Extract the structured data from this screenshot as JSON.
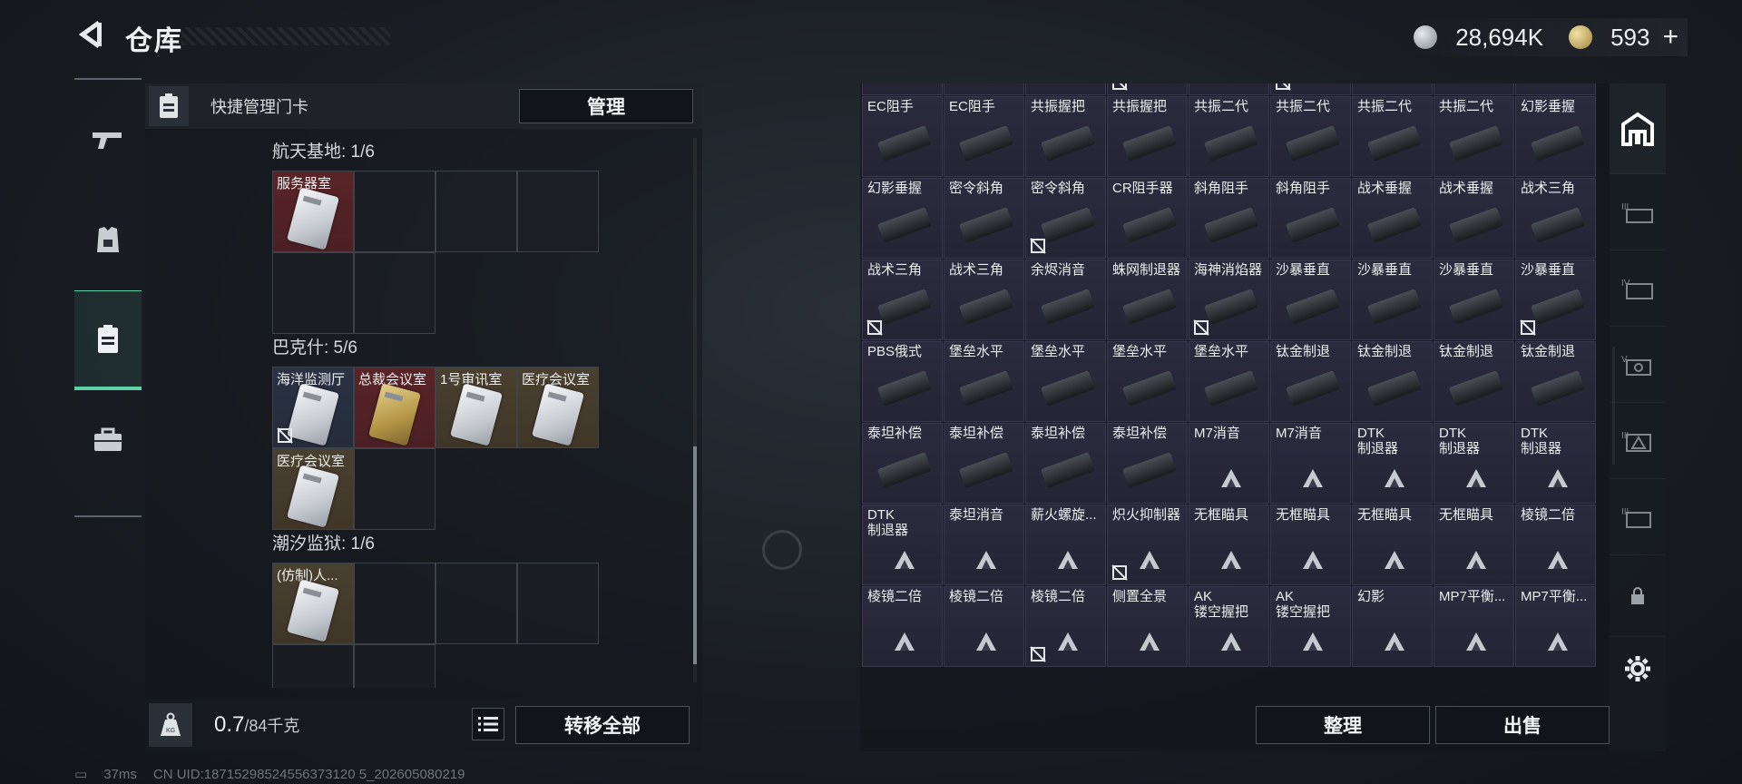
{
  "header": {
    "title": "仓库",
    "currency_silver": "28,694K",
    "currency_gold": "593",
    "currency_gold_add": "+"
  },
  "left_panel": {
    "keycard_label": "快捷管理门卡",
    "manage_label": "管理",
    "sections": [
      {
        "title": "航天基地: 1/6",
        "cards": [
          {
            "label": "服务器室"
          }
        ]
      },
      {
        "title": "巴克什: 5/6",
        "cards": [
          {
            "label": "海洋监测厅"
          },
          {
            "label": "总裁会议室"
          },
          {
            "label": "1号审讯室"
          },
          {
            "label": "医疗会议室"
          },
          {
            "label": "医疗会议室"
          }
        ]
      },
      {
        "title": "潮汐监狱: 1/6",
        "cards": [
          {
            "label": "(仿制)人..."
          }
        ]
      }
    ],
    "weight_value": "0.7",
    "weight_max": "/84千克",
    "transfer_label": "转移全部"
  },
  "right_panel": {
    "items": [
      {
        "name": ""
      },
      {
        "name": ""
      },
      {
        "name": ""
      },
      {
        "name": ""
      },
      {
        "name": ""
      },
      {
        "name": ""
      },
      {
        "name": ""
      },
      {
        "name": ""
      },
      {
        "name": ""
      },
      {
        "name": "EC阻手"
      },
      {
        "name": "EC阻手"
      },
      {
        "name": "共振握把"
      },
      {
        "name": "共振握把"
      },
      {
        "name": "共振二代"
      },
      {
        "name": "共振二代"
      },
      {
        "name": "共振二代"
      },
      {
        "name": "共振二代"
      },
      {
        "name": "幻影垂握"
      },
      {
        "name": "幻影垂握"
      },
      {
        "name": "密令斜角"
      },
      {
        "name": "密令斜角"
      },
      {
        "name": "CR阻手器"
      },
      {
        "name": "斜角阻手"
      },
      {
        "name": "斜角阻手"
      },
      {
        "name": "战术垂握"
      },
      {
        "name": "战术垂握"
      },
      {
        "name": "战术三角"
      },
      {
        "name": "战术三角"
      },
      {
        "name": "战术三角"
      },
      {
        "name": "余烬消音"
      },
      {
        "name": "蛛网制退器"
      },
      {
        "name": "海神消焰器"
      },
      {
        "name": "沙暴垂直"
      },
      {
        "name": "沙暴垂直"
      },
      {
        "name": "沙暴垂直"
      },
      {
        "name": "沙暴垂直"
      },
      {
        "name": "PBS俄式"
      },
      {
        "name": "堡垒水平"
      },
      {
        "name": "堡垒水平"
      },
      {
        "name": "堡垒水平"
      },
      {
        "name": "堡垒水平"
      },
      {
        "name": "钛金制退"
      },
      {
        "name": "钛金制退"
      },
      {
        "name": "钛金制退"
      },
      {
        "name": "钛金制退"
      },
      {
        "name": "泰坦补偿"
      },
      {
        "name": "泰坦补偿"
      },
      {
        "name": "泰坦补偿"
      },
      {
        "name": "泰坦补偿"
      },
      {
        "name": "M7消音"
      },
      {
        "name": "M7消音"
      },
      {
        "name": "DTK\n制退器"
      },
      {
        "name": "DTK\n制退器"
      },
      {
        "name": "DTK\n制退器"
      },
      {
        "name": "DTK\n制退器"
      },
      {
        "name": "泰坦消音"
      },
      {
        "name": "薪火螺旋..."
      },
      {
        "name": "炽火抑制器"
      },
      {
        "name": "无框瞄具"
      },
      {
        "name": "无框瞄具"
      },
      {
        "name": "无框瞄具"
      },
      {
        "name": "无框瞄具"
      },
      {
        "name": "棱镜二倍"
      },
      {
        "name": "棱镜二倍"
      },
      {
        "name": "棱镜二倍"
      },
      {
        "name": "棱镜二倍"
      },
      {
        "name": "侧置全景"
      },
      {
        "name": "AK\n镂空握把"
      },
      {
        "name": "AK\n镂空握把"
      },
      {
        "name": "幻影"
      },
      {
        "name": "MP7平衡..."
      },
      {
        "name": "MP7平衡..."
      }
    ],
    "sort_label": "整理",
    "sell_label": "出售"
  },
  "status": {
    "ping": "37ms",
    "uid": "CN UID:18715298524556373120 5_202605080219"
  }
}
